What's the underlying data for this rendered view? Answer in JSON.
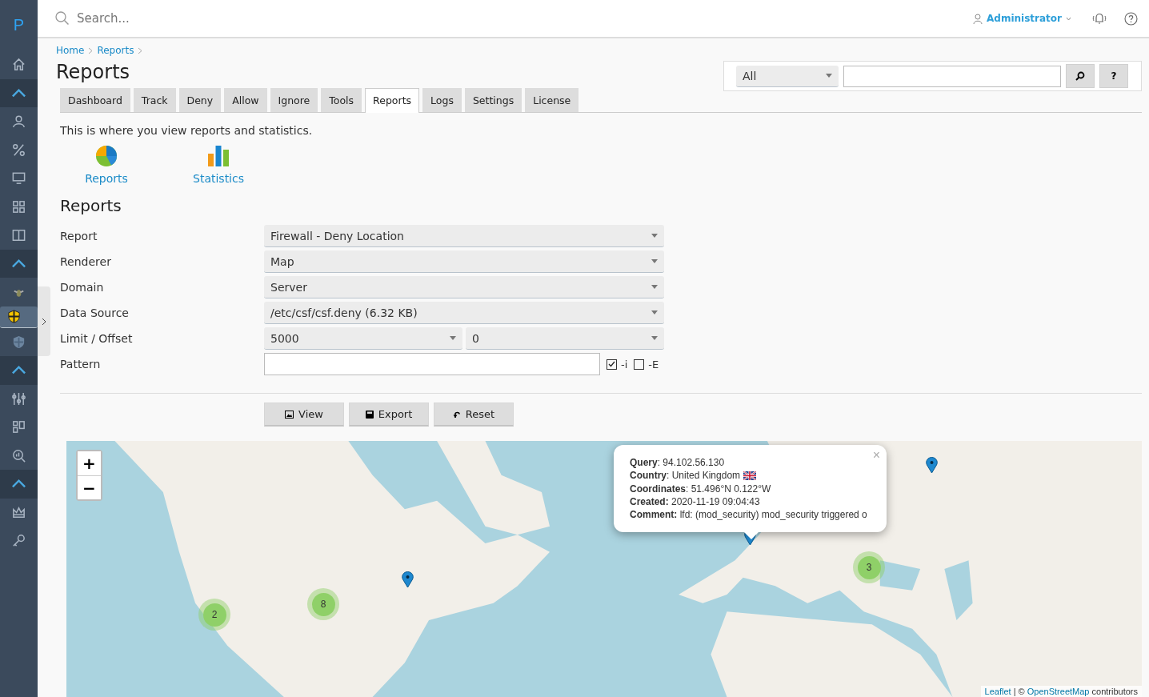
{
  "sidebar": {
    "logo": "P",
    "items": [
      {
        "kind": "link",
        "selected": false
      },
      {
        "kind": "toggle",
        "selected": false
      },
      {
        "kind": "link",
        "selected": false
      },
      {
        "kind": "link",
        "selected": false
      },
      {
        "kind": "link",
        "selected": false
      },
      {
        "kind": "link",
        "selected": false
      },
      {
        "kind": "link",
        "selected": false
      },
      {
        "kind": "toggle",
        "selected": false
      },
      {
        "kind": "link",
        "selected": false
      },
      {
        "kind": "link",
        "selected": true
      },
      {
        "kind": "link",
        "selected": false
      },
      {
        "kind": "toggle",
        "selected": false
      },
      {
        "kind": "link",
        "selected": false
      },
      {
        "kind": "link",
        "selected": false
      },
      {
        "kind": "link",
        "selected": false
      },
      {
        "kind": "toggle",
        "selected": false
      },
      {
        "kind": "link",
        "selected": false
      },
      {
        "kind": "link",
        "selected": false
      }
    ]
  },
  "topbar": {
    "search": {
      "placeholder": "Search..."
    },
    "user": "Administrator"
  },
  "breadcrumb": [
    "Home",
    "Reports"
  ],
  "title": "Reports",
  "quick_search": {
    "scope": "All",
    "help": "?"
  },
  "tabs": [
    {
      "label": "Dashboard",
      "selected": false
    },
    {
      "label": "Track",
      "selected": false
    },
    {
      "label": "Deny",
      "selected": false
    },
    {
      "label": "Allow",
      "selected": false
    },
    {
      "label": "Ignore",
      "selected": false
    },
    {
      "label": "Tools",
      "selected": false
    },
    {
      "label": "Reports",
      "selected": true
    },
    {
      "label": "Logs",
      "selected": false
    },
    {
      "label": "Settings",
      "selected": false
    },
    {
      "label": "License",
      "selected": false
    }
  ],
  "description": "This is where you view reports and statistics.",
  "shortcuts": [
    {
      "kind": "pie",
      "label": "Reports"
    },
    {
      "kind": "bars",
      "label": "Statistics"
    }
  ],
  "section_title": "Reports",
  "form": [
    {
      "kind": "select",
      "label": "Report",
      "values": [
        "Firewall - Deny Location"
      ]
    },
    {
      "kind": "select",
      "label": "Renderer",
      "values": [
        "Map"
      ]
    },
    {
      "kind": "select",
      "label": "Domain",
      "values": [
        "Server"
      ]
    },
    {
      "kind": "select",
      "label": "Data Source",
      "values": [
        "/etc/csf/csf.deny (6.32 KB)"
      ]
    },
    {
      "kind": "select",
      "label": "Limit / Offset",
      "values": [
        "5000",
        "0"
      ]
    },
    {
      "kind": "pattern",
      "label": "Pattern",
      "options": [
        {
          "label": "-i",
          "checked": true
        },
        {
          "label": "-E",
          "checked": false
        }
      ]
    }
  ],
  "buttons": [
    {
      "kind": "view",
      "label": "View"
    },
    {
      "kind": "export",
      "label": "Export"
    },
    {
      "kind": "reset",
      "label": "Reset"
    }
  ],
  "map": {
    "zoom_in": "+",
    "zoom_out": "−",
    "clusters": [
      {
        "count": "2"
      },
      {
        "count": "8"
      },
      {
        "count": "3"
      }
    ],
    "popup": {
      "close": "×",
      "lines": [
        "**Query**: 94.102.56.130",
        "**Country**: United Kingdom",
        "**Coordinates**: 51.496°N 0.122°W",
        "**Created:** 2020-11-19 09:04:43",
        "**Comment:** lfd: (mod_security) mod_security triggered o"
      ]
    },
    "attribution": {
      "link_1": "Leaflet",
      "middle": "| ©",
      "link_2": "OpenStreetMap",
      "end": "contributors"
    }
  }
}
